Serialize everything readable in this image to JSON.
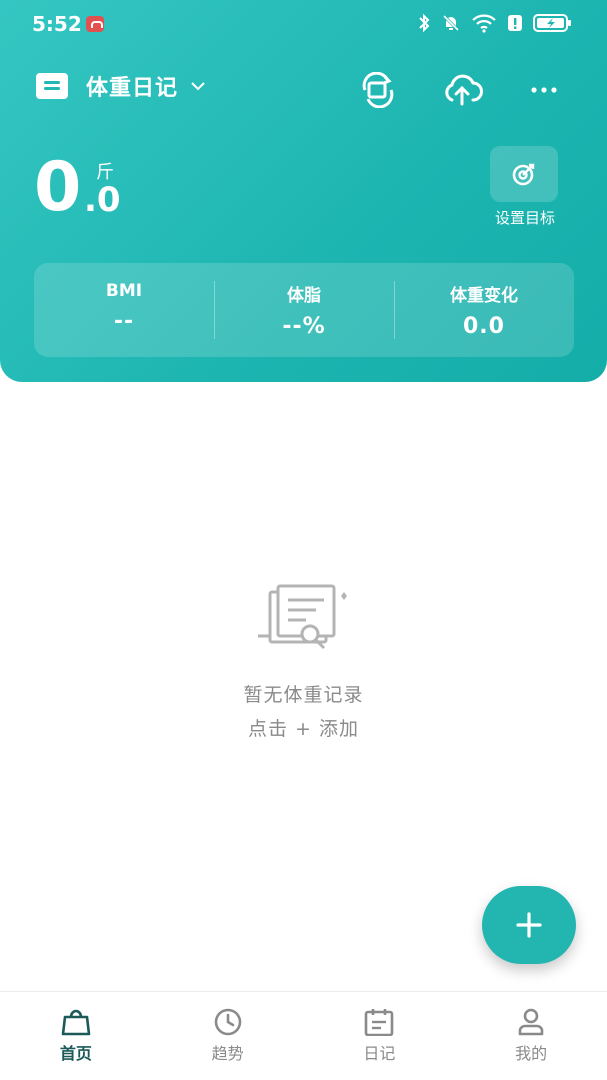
{
  "status_bar": {
    "time": "5:52",
    "icons": [
      "huawei-badge-icon",
      "bluetooth-icon",
      "bell-muted-icon",
      "wifi-icon",
      "alert-icon",
      "battery-charging-icon"
    ]
  },
  "header": {
    "title": "体重日记",
    "actions": [
      "rotate-icon",
      "cloud-upload-icon",
      "more-icon"
    ],
    "weight": {
      "integer": "0",
      "unit": "斤",
      "decimal": ".0"
    },
    "target_label": "设置目标"
  },
  "stats": [
    {
      "label": "BMI",
      "value": "--"
    },
    {
      "label": "体脂",
      "value": "--%"
    },
    {
      "label": "体重变化",
      "value": "0.0"
    }
  ],
  "empty_state": {
    "title": "暂无体重记录",
    "hint": "点击 + 添加"
  },
  "tabs": [
    {
      "label": "首页",
      "icon": "home-bag-icon",
      "active": true
    },
    {
      "label": "趋势",
      "icon": "clock-icon",
      "active": false
    },
    {
      "label": "日记",
      "icon": "calendar-icon",
      "active": false
    },
    {
      "label": "我的",
      "icon": "profile-icon",
      "active": false
    }
  ],
  "colors": {
    "accent": "#23b6b1",
    "header_gradient_start": "#35c6c2",
    "header_gradient_end": "#14ada8",
    "active_tab": "#1b5a58",
    "muted_text": "#8a8a8a"
  }
}
